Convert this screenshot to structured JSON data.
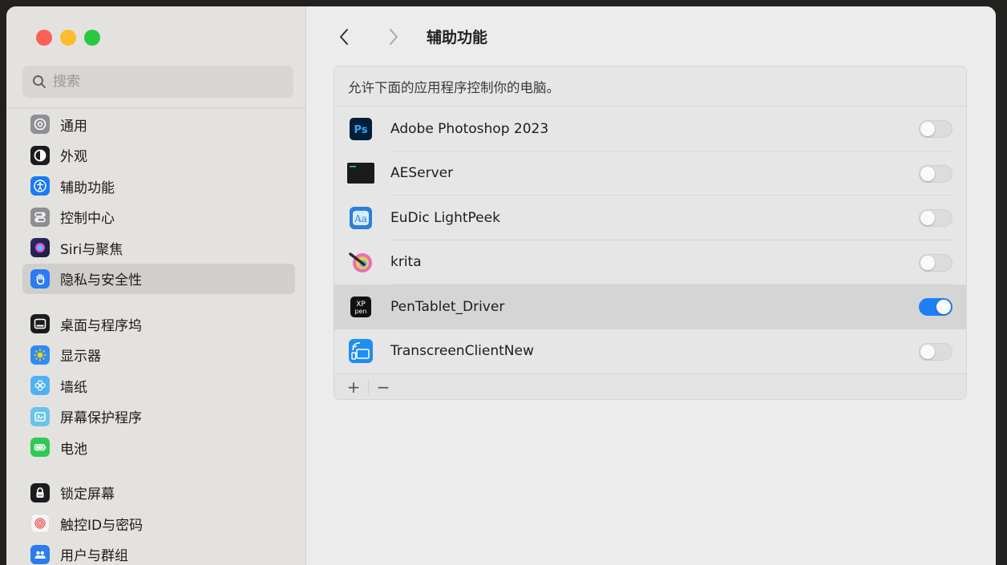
{
  "sidebar": {
    "search_placeholder": "搜索",
    "items": [
      {
        "label": "通用",
        "icon": "gear-icon",
        "color": "#8e8e93"
      },
      {
        "label": "外观",
        "icon": "appearance-icon",
        "color": "#1c1c1e"
      },
      {
        "label": "辅助功能",
        "icon": "accessibility-icon",
        "color": "#1a7bf2"
      },
      {
        "label": "控制中心",
        "icon": "control-center-icon",
        "color": "#8e8e93"
      },
      {
        "label": "Siri与聚焦",
        "icon": "siri-icon",
        "color": "#3a3a8c"
      },
      {
        "label": "隐私与安全性",
        "icon": "hand-icon",
        "color": "#2a7cf0"
      },
      {
        "label": "桌面与程序坞",
        "icon": "dock-icon",
        "color": "#1c1c1e"
      },
      {
        "label": "显示器",
        "icon": "brightness-icon",
        "color": "#2f8cf5"
      },
      {
        "label": "墙纸",
        "icon": "flower-icon",
        "color": "#4fb1f5"
      },
      {
        "label": "屏幕保护程序",
        "icon": "screensaver-icon",
        "color": "#6ac3e8"
      },
      {
        "label": "电池",
        "icon": "battery-icon",
        "color": "#34c759"
      },
      {
        "label": "锁定屏幕",
        "icon": "lock-icon",
        "color": "#1c1c1e"
      },
      {
        "label": "触控ID与密码",
        "icon": "fingerprint-icon",
        "color": "#f5f5f5"
      },
      {
        "label": "用户与群组",
        "icon": "users-icon",
        "color": "#2a7cf0"
      }
    ]
  },
  "main": {
    "title": "辅助功能",
    "description": "允许下面的应用程序控制你的电脑。",
    "apps": [
      {
        "name": "Adobe Photoshop 2023",
        "icon": "photoshop-icon",
        "enabled": false
      },
      {
        "name": "AEServer",
        "icon": "terminal-icon",
        "enabled": false
      },
      {
        "name": "EuDic LightPeek",
        "icon": "eudic-icon",
        "enabled": false
      },
      {
        "name": "krita",
        "icon": "krita-icon",
        "enabled": false
      },
      {
        "name": "PenTablet_Driver",
        "icon": "xppen-icon",
        "enabled": true
      },
      {
        "name": "TranscreenClientNew",
        "icon": "transcreen-icon",
        "enabled": false
      }
    ],
    "footer": {
      "add": "+",
      "remove": "−"
    }
  },
  "colors": {
    "accent": "#1f7ef5",
    "selected_sidebar": "#d1cfcc"
  }
}
